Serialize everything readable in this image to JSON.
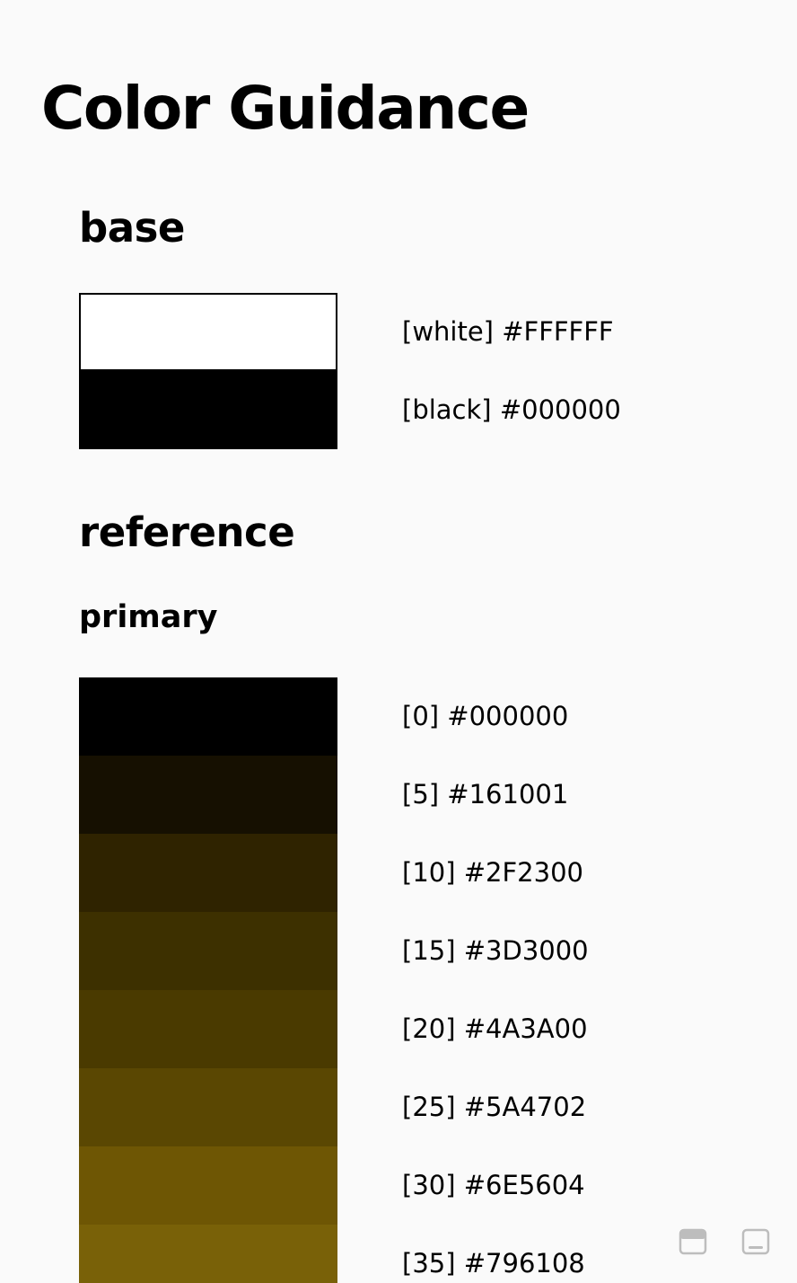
{
  "page": {
    "title": "Color Guidance"
  },
  "base": {
    "title": "base",
    "swatches": [
      {
        "name": "white",
        "hex": "#FFFFFF",
        "label": "[white] #FFFFFF",
        "outlined": true
      },
      {
        "name": "black",
        "hex": "#000000",
        "label": "[black] #000000",
        "outlined": false
      }
    ]
  },
  "reference": {
    "title": "reference",
    "primary": {
      "title": "primary",
      "swatches": [
        {
          "tone": "0",
          "hex": "#000000",
          "label": "[0] #000000"
        },
        {
          "tone": "5",
          "hex": "#161001",
          "label": "[5] #161001"
        },
        {
          "tone": "10",
          "hex": "#2F2300",
          "label": "[10] #2F2300"
        },
        {
          "tone": "15",
          "hex": "#3D3000",
          "label": "[15] #3D3000"
        },
        {
          "tone": "20",
          "hex": "#4A3A00",
          "label": "[20] #4A3A00"
        },
        {
          "tone": "25",
          "hex": "#5A4702",
          "label": "[25] #5A4702"
        },
        {
          "tone": "30",
          "hex": "#6E5604",
          "label": "[30] #6E5604"
        },
        {
          "tone": "35",
          "hex": "#796108",
          "label": "[35] #796108"
        }
      ]
    }
  },
  "controls": {
    "icon_color": "#bdbdbd",
    "top_bar_icon": "top-bar-toggle-icon",
    "bottom_bar_icon": "bottom-bar-toggle-icon"
  }
}
